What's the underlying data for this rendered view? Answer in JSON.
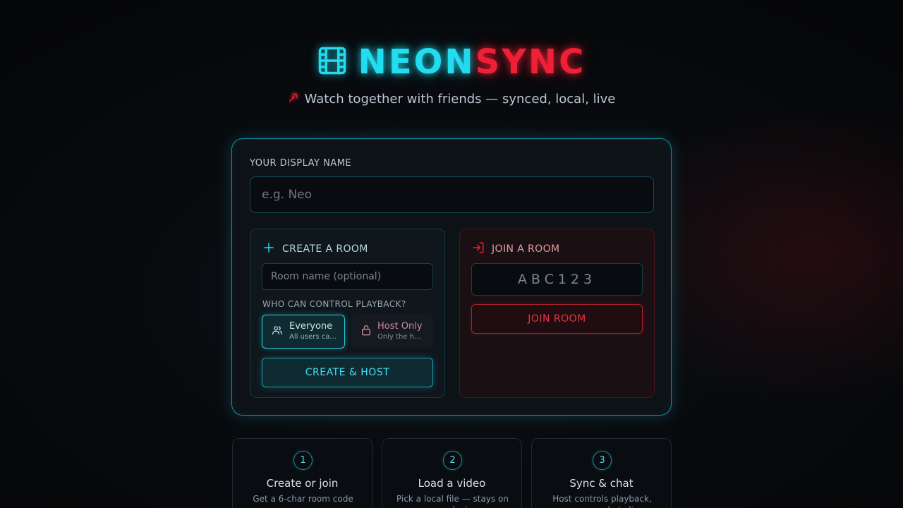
{
  "brand": {
    "part1": "NEON",
    "part2": "SYNC",
    "icon": "film-icon",
    "tagline": "Watch together with friends — synced, local, live",
    "tagline_icon": "sparkle-icon"
  },
  "colors": {
    "cyan": "#22dcef",
    "red": "#ef1f35",
    "background": "#07090c"
  },
  "form": {
    "display_name_label": "YOUR DISPLAY NAME",
    "display_name_placeholder": "e.g. Neo",
    "display_name_value": ""
  },
  "create": {
    "heading": "CREATE A ROOM",
    "heading_icon": "plus-icon",
    "room_name_placeholder": "Room name (optional)",
    "control_label": "WHO CAN CONTROL PLAYBACK?",
    "options": [
      {
        "title": "Everyone",
        "subtitle": "All users can...",
        "icon": "users-icon",
        "selected": true
      },
      {
        "title": "Host Only",
        "subtitle": "Only the hos...",
        "icon": "lock-icon",
        "selected": false
      }
    ],
    "button": "CREATE & HOST"
  },
  "join": {
    "heading": "JOIN A ROOM",
    "heading_icon": "log-in-icon",
    "code_placeholder": "ABC123",
    "button": "JOIN ROOM"
  },
  "steps": [
    {
      "num": "1",
      "title": "Create or join",
      "desc": "Get a 6-char room code"
    },
    {
      "num": "2",
      "title": "Load a video",
      "desc": "Pick a local file — stays on your device"
    },
    {
      "num": "3",
      "title": "Sync & chat",
      "desc": "Host controls playback, everyone chats live"
    }
  ]
}
